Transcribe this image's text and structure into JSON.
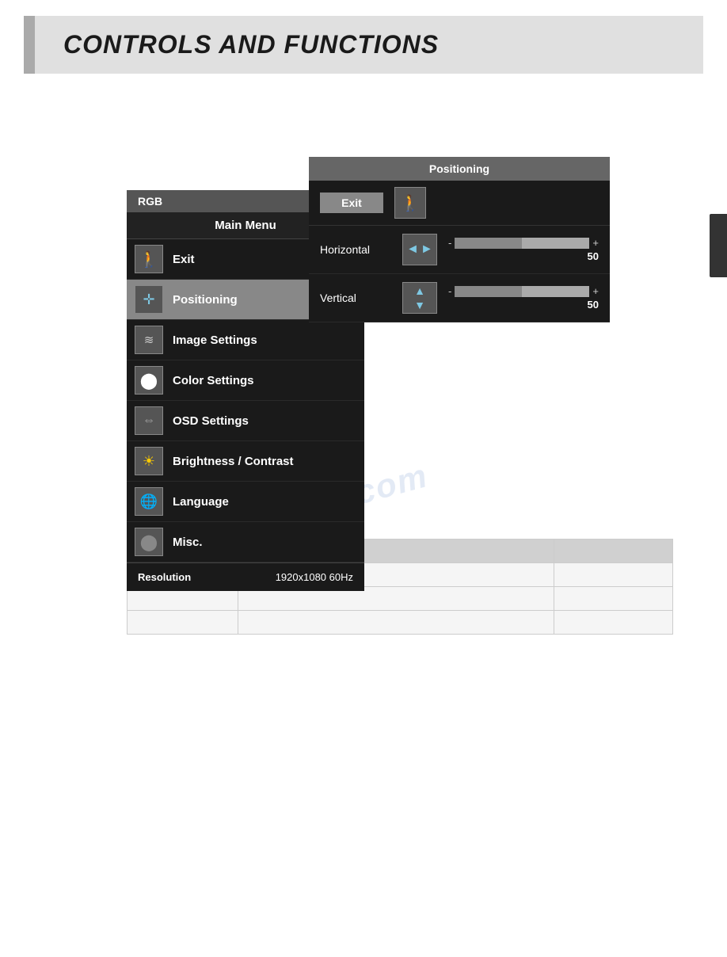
{
  "page": {
    "title": "CONTROLS AND FUNCTIONS"
  },
  "osd": {
    "header_label": "RGB",
    "title": "Main Menu",
    "items": [
      {
        "id": "exit",
        "label": "Exit",
        "icon": "exit-icon",
        "active": false
      },
      {
        "id": "positioning",
        "label": "Positioning",
        "icon": "positioning-icon",
        "active": true
      },
      {
        "id": "image-settings",
        "label": "Image Settings",
        "icon": "image-settings-icon",
        "active": false
      },
      {
        "id": "color-settings",
        "label": "Color Settings",
        "icon": "color-settings-icon",
        "active": false
      },
      {
        "id": "osd-settings",
        "label": "OSD Settings",
        "icon": "osd-settings-icon",
        "active": false
      },
      {
        "id": "brightness-contrast",
        "label": "Brightness / Contrast",
        "icon": "brightness-icon",
        "active": false
      },
      {
        "id": "language",
        "label": "Language",
        "icon": "language-icon",
        "active": false
      },
      {
        "id": "misc",
        "label": "Misc.",
        "icon": "misc-icon",
        "active": false
      }
    ],
    "footer": {
      "resolution_label": "Resolution",
      "resolution_value": "1920x1080 60Hz"
    }
  },
  "positioning_panel": {
    "title": "Positioning",
    "exit_label": "Exit",
    "horizontal_label": "Horizontal",
    "horizontal_value": "50",
    "vertical_label": "Vertical",
    "vertical_value": "50",
    "slider_min": "-",
    "slider_max": "+"
  },
  "table": {
    "rows": [
      [
        "",
        "",
        ""
      ],
      [
        "",
        "",
        ""
      ],
      [
        "",
        "",
        ""
      ],
      [
        "",
        "",
        ""
      ]
    ]
  },
  "watermark": "manualslib.com"
}
